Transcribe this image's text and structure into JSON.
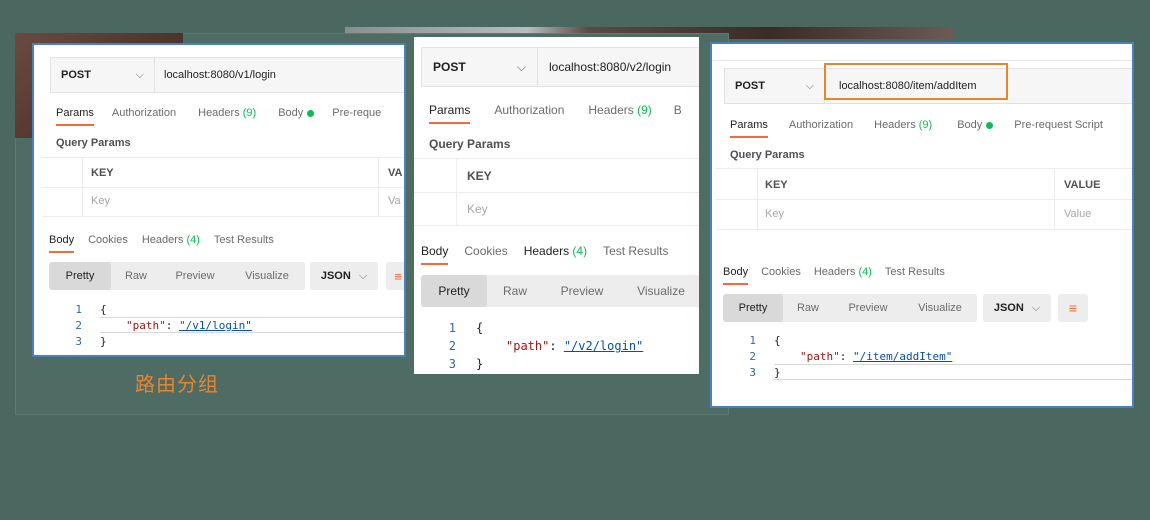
{
  "caption": "路由分组",
  "panels": [
    {
      "method": "POST",
      "url": "localhost:8080/v1/login",
      "tabs": [
        "Params",
        "Authorization",
        "Headers",
        "Body",
        "Pre-reque"
      ],
      "headers_count": "(9)",
      "query_params_label": "Query Params",
      "table": {
        "key_header": "KEY",
        "value_header": "VA",
        "key_placeholder": "Key",
        "value_placeholder": "Va"
      },
      "response_tabs": [
        "Body",
        "Cookies",
        "Headers",
        "Test Results"
      ],
      "response_headers_count": "(4)",
      "view_modes": [
        "Pretty",
        "Raw",
        "Preview",
        "Visualize"
      ],
      "format": "JSON",
      "code": {
        "lines": [
          "1",
          "2",
          "3"
        ],
        "open": "{",
        "key": "\"path\"",
        "colon": ": ",
        "value": "\"/v1/login\"",
        "close": "}"
      }
    },
    {
      "method": "POST",
      "url": "localhost:8080/v2/login",
      "tabs": [
        "Params",
        "Authorization",
        "Headers",
        "B"
      ],
      "headers_count": "(9)",
      "query_params_label": "Query Params",
      "table": {
        "key_header": "KEY",
        "key_placeholder": "Key"
      },
      "response_tabs": [
        "Body",
        "Cookies",
        "Headers",
        "Test Results"
      ],
      "response_headers_count": "(4)",
      "view_modes": [
        "Pretty",
        "Raw",
        "Preview",
        "Visualize"
      ],
      "code": {
        "lines": [
          "1",
          "2",
          "3"
        ],
        "open": "{",
        "key": "\"path\"",
        "colon": ": ",
        "value": "\"/v2/login\"",
        "close": "}"
      }
    },
    {
      "method": "POST",
      "url": "localhost:8080/item/addItem",
      "tabs": [
        "Params",
        "Authorization",
        "Headers",
        "Body",
        "Pre-request Script"
      ],
      "headers_count": "(9)",
      "query_params_label": "Query Params",
      "table": {
        "key_header": "KEY",
        "value_header": "VALUE",
        "key_placeholder": "Key",
        "value_placeholder": "Value"
      },
      "response_tabs": [
        "Body",
        "Cookies",
        "Headers",
        "Test Results"
      ],
      "response_headers_count": "(4)",
      "view_modes": [
        "Pretty",
        "Raw",
        "Preview",
        "Visualize"
      ],
      "format": "JSON",
      "code": {
        "lines": [
          "1",
          "2",
          "3"
        ],
        "open": "{",
        "key": "\"path\"",
        "colon": ": ",
        "value": "\"/item/addItem\"",
        "close": "}"
      }
    }
  ],
  "icons": {
    "dropdown": "chevron-down-icon",
    "wrap": "wrap-lines-icon",
    "body_dot": "status-dot-icon"
  },
  "colors": {
    "accent": "#f26b3a",
    "count_green": "#0cbb52",
    "caption_orange": "#e8852f",
    "panel_border": "#4a7fc0"
  }
}
